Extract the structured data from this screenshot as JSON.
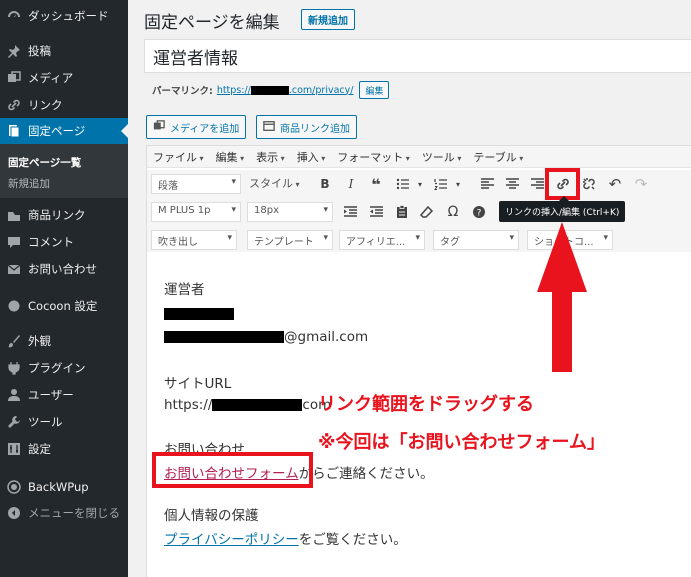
{
  "sidebar": {
    "items": [
      {
        "label": "ダッシュボード",
        "icon": "dashboard-icon"
      },
      {
        "label": "投稿",
        "icon": "pin-icon"
      },
      {
        "label": "メディア",
        "icon": "media-icon"
      },
      {
        "label": "リンク",
        "icon": "link-icon"
      },
      {
        "label": "固定ページ",
        "icon": "page-icon",
        "active": true
      },
      {
        "label": "商品リンク",
        "icon": "product-link-icon"
      },
      {
        "label": "コメント",
        "icon": "comment-icon"
      },
      {
        "label": "お問い合わせ",
        "icon": "mail-icon"
      },
      {
        "label": "Cocoon 設定",
        "icon": "cocoon-icon"
      },
      {
        "label": "外観",
        "icon": "brush-icon"
      },
      {
        "label": "プラグイン",
        "icon": "plugin-icon"
      },
      {
        "label": "ユーザー",
        "icon": "user-icon"
      },
      {
        "label": "ツール",
        "icon": "wrench-icon"
      },
      {
        "label": "設定",
        "icon": "settings-icon"
      },
      {
        "label": "BackWPup",
        "icon": "backwpup-icon"
      },
      {
        "label": "メニューを閉じる",
        "icon": "collapse-icon"
      }
    ],
    "submenu": [
      {
        "label": "固定ページ一覧",
        "current": true
      },
      {
        "label": "新規追加",
        "current": false
      }
    ]
  },
  "header": {
    "title": "固定ページを編集",
    "add_new": "新規追加"
  },
  "post_title": "運営者情報",
  "permalink": {
    "label": "パーマリンク:",
    "url_prefix": "https://",
    "url_suffix": ".com/privacy/",
    "edit": "編集"
  },
  "media_buttons": {
    "add_media": "メディアを追加",
    "product_link": "商品リンク追加"
  },
  "editor": {
    "menubar": [
      "ファイル",
      "編集",
      "表示",
      "挿入",
      "フォーマット",
      "ツール",
      "テーブル"
    ],
    "row1": {
      "format": "段落",
      "style": "スタイル"
    },
    "row2": {
      "font": "M PLUS 1p",
      "size": "18px"
    },
    "row3": {
      "balloon": "吹き出し",
      "template": "テンプレート",
      "affiliate": "アフィリエ...",
      "tag": "タグ",
      "shortcode": "ショートコ..."
    }
  },
  "content": {
    "operator_heading": "運営者",
    "email_suffix": "@gmail.com",
    "site_url_heading": "サイトURL",
    "site_url_prefix": "https://",
    "site_url_suffix": "com",
    "contact_heading": "お問い合わせ",
    "contact_link": "お問い合わせフォーム",
    "contact_rest": "からご連絡ください。",
    "privacy_heading": "個人情報の保護",
    "privacy_link": "プライバシーポリシー",
    "privacy_rest": "をご覧ください。"
  },
  "tooltip": "リンクの挿入/編集 (Ctrl+K)",
  "annotations": {
    "line1": "リンク範囲をドラッグする",
    "line2": "※今回は「お問い合わせフォーム」"
  },
  "colors": {
    "sidebar_bg": "#23282d",
    "active_bg": "#0073aa",
    "annotation_red": "#e8131d",
    "link_blue": "#0073aa"
  }
}
